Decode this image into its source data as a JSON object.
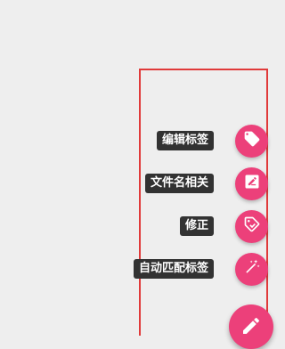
{
  "accent_color": "#ec407a",
  "highlight_border_color": "#e03a3a",
  "menu": {
    "items": [
      {
        "label": "编辑标签",
        "icon": "tag-icon"
      },
      {
        "label": "文件名相关",
        "icon": "edit-icon"
      },
      {
        "label": "修正",
        "icon": "tag-check-icon"
      },
      {
        "label": "自动匹配标签",
        "icon": "magic-wand-icon"
      }
    ]
  },
  "main_fab": {
    "icon": "pencil-icon"
  }
}
